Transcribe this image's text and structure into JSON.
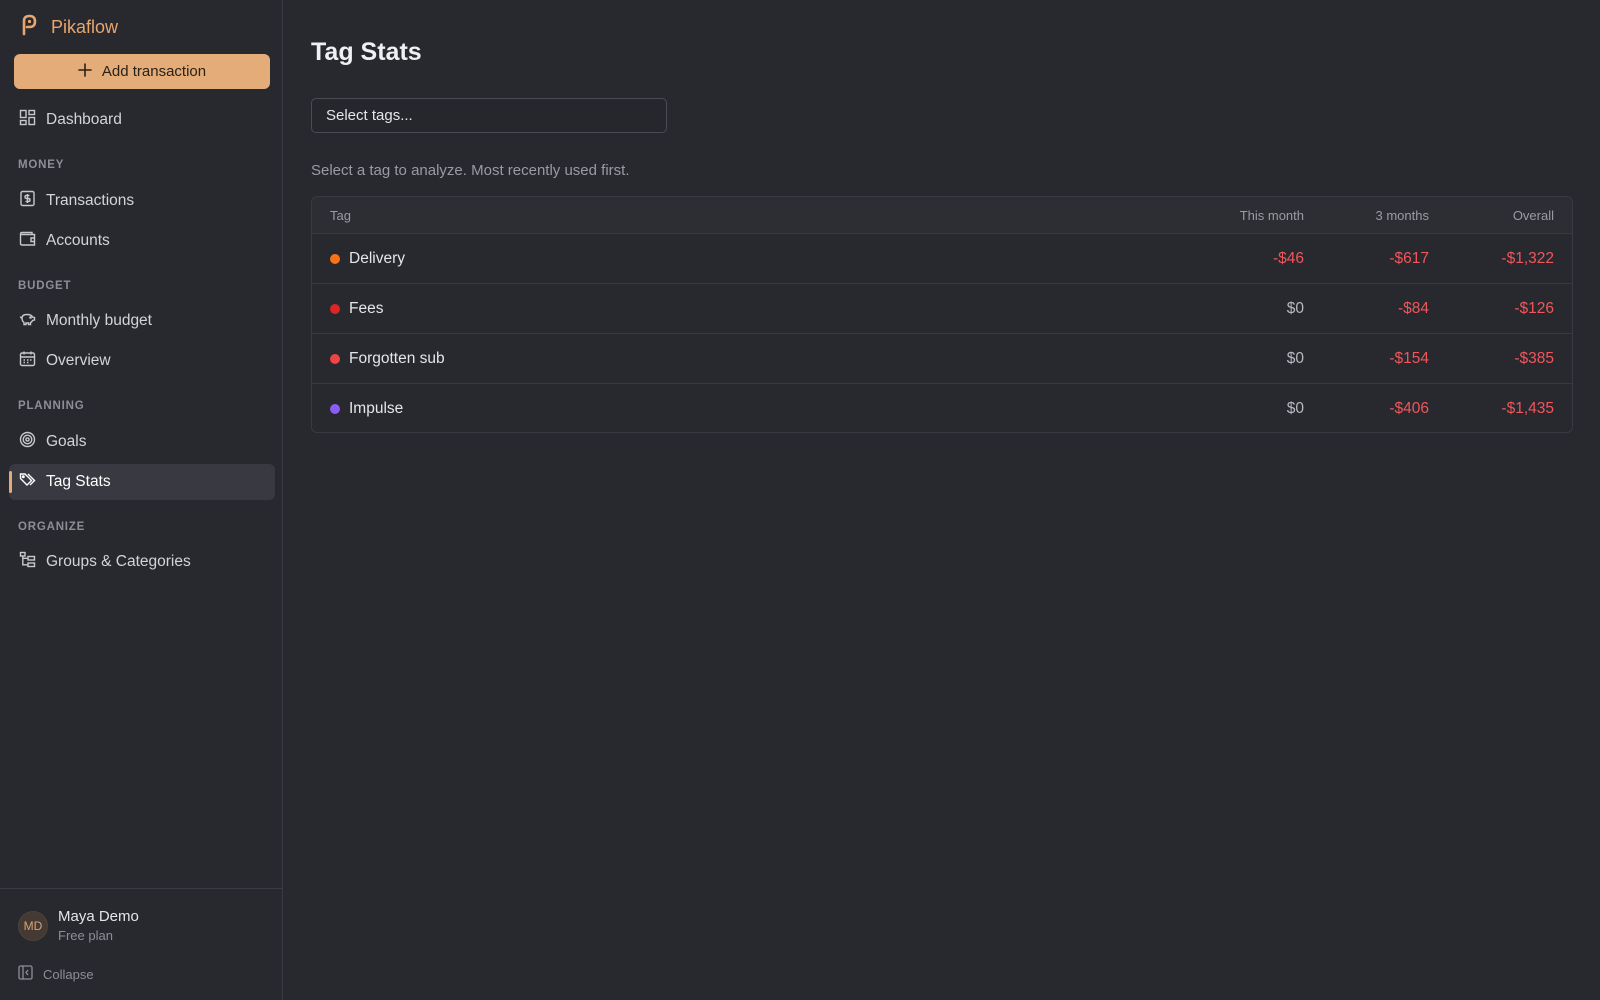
{
  "app": {
    "name": "Pikaflow"
  },
  "sidebar": {
    "add_label": "Add transaction",
    "dashboard": "Dashboard",
    "sections": {
      "money": "MONEY",
      "budget": "BUDGET",
      "planning": "PLANNING",
      "organize": "ORGANIZE"
    },
    "items": {
      "transactions": "Transactions",
      "accounts": "Accounts",
      "monthly_budget": "Monthly budget",
      "overview": "Overview",
      "goals": "Goals",
      "tag_stats": "Tag Stats",
      "groups_categories": "Groups & Categories"
    },
    "active": "tag_stats",
    "user": {
      "initials": "MD",
      "name": "Maya Demo",
      "plan": "Free plan"
    },
    "collapse_label": "Collapse"
  },
  "main": {
    "title": "Tag Stats",
    "select_placeholder": "Select tags...",
    "helper": "Select a tag to analyze. Most recently used first.",
    "table": {
      "headers": {
        "tag": "Tag",
        "this_month": "This month",
        "three_months": "3 months",
        "overall": "Overall"
      },
      "rows": [
        {
          "tag": "Delivery",
          "color": "#f97316",
          "this_month": "-$46",
          "three_months": "-$617",
          "overall": "-$1,322"
        },
        {
          "tag": "Fees",
          "color": "#dc2626",
          "this_month": "$0",
          "three_months": "-$84",
          "overall": "-$126"
        },
        {
          "tag": "Forgotten sub",
          "color": "#ef4444",
          "this_month": "$0",
          "three_months": "-$154",
          "overall": "-$385"
        },
        {
          "tag": "Impulse",
          "color": "#8b5cf6",
          "this_month": "$0",
          "three_months": "-$406",
          "overall": "-$1,435"
        }
      ]
    }
  },
  "colors": {
    "accent": "#e3ac78",
    "negative": "#f0565a",
    "background": "#28292f"
  }
}
